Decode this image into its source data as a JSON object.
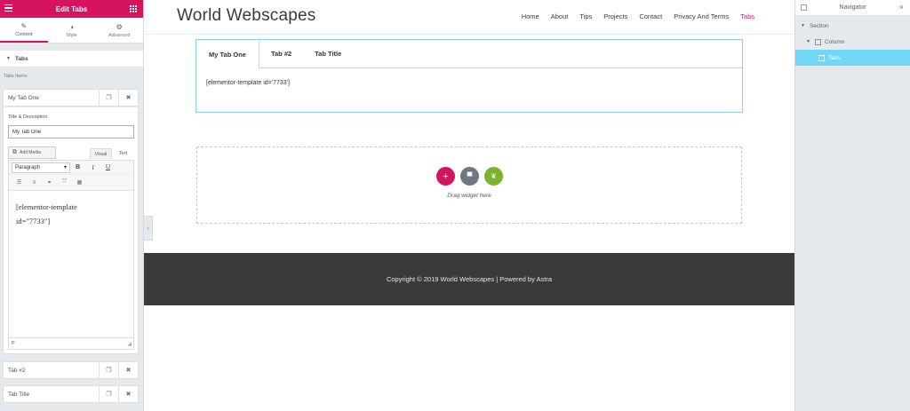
{
  "panel": {
    "title": "Edit Tabs",
    "tabs": [
      {
        "label": "Content",
        "icon": "pencil-icon",
        "glyph": "✎"
      },
      {
        "label": "Style",
        "icon": "half-circle-icon",
        "glyph": "◑"
      },
      {
        "label": "Advanced",
        "icon": "gear-icon",
        "glyph": "⚙"
      }
    ],
    "section_title": "Tabs",
    "tabs_items_label": "Tabs Items",
    "items": [
      {
        "label": "My Tab One"
      },
      {
        "label": "Tab #2"
      },
      {
        "label": "Tab Title"
      }
    ],
    "field_label": "Title & Description",
    "field_value": "My Tab One",
    "add_media_label": "Add Media",
    "editor_tab_visual": "Visual",
    "editor_tab_text": "Text",
    "paragraph_select": "Paragraph",
    "editor_content_line1": "[elementor-template",
    "editor_content_line2": "id=\"7733\"]",
    "statusbar": "P",
    "accent_color": "#d5135e"
  },
  "site": {
    "title": "World Webscapes",
    "nav": [
      "Home",
      "About",
      "Tips",
      "Projects",
      "Contact",
      "Privacy And Terms",
      "Tabs"
    ],
    "current_nav": "Tabs"
  },
  "tabs_widget": {
    "tabs": [
      "My Tab One",
      "Tab #2",
      "Tab Title"
    ],
    "content": "[elementor-template id='7733']"
  },
  "dropzone": {
    "label": "Drag widget here"
  },
  "footer": {
    "text": "Copyright © 2019 World Webscapes | Powered by Astra"
  },
  "navigator": {
    "title": "Navigator",
    "rows": [
      {
        "label": "Section"
      },
      {
        "label": "Column"
      },
      {
        "label": "Tabs"
      }
    ],
    "selected_color": "#71d7f7"
  }
}
